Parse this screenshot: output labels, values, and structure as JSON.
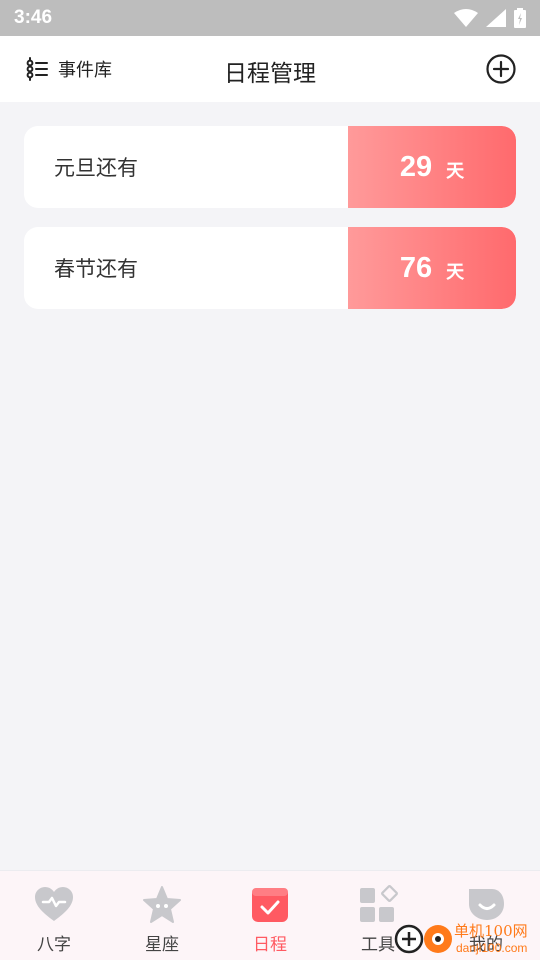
{
  "status_bar": {
    "time": "3:46"
  },
  "header": {
    "library_label": "事件库",
    "title": "日程管理"
  },
  "events": [
    {
      "name": "元旦还有",
      "days": "29",
      "unit": "天"
    },
    {
      "name": "春节还有",
      "days": "76",
      "unit": "天"
    }
  ],
  "bottom_nav": [
    {
      "label": "八字",
      "icon": "heart-icon",
      "active": false
    },
    {
      "label": "星座",
      "icon": "star-icon",
      "active": false
    },
    {
      "label": "日程",
      "icon": "calendar-check-icon",
      "active": true
    },
    {
      "label": "工具",
      "icon": "grid-icon",
      "active": false
    },
    {
      "label": "我的",
      "icon": "profile-icon",
      "active": false
    }
  ],
  "watermark": {
    "name": "单机100网",
    "url": "danji100.com"
  },
  "colors": {
    "accent": "#ff5a62",
    "gradient_start": "#ff9a9a",
    "gradient_end": "#ff6a6d",
    "inactive_icon": "#c8c8cc"
  }
}
